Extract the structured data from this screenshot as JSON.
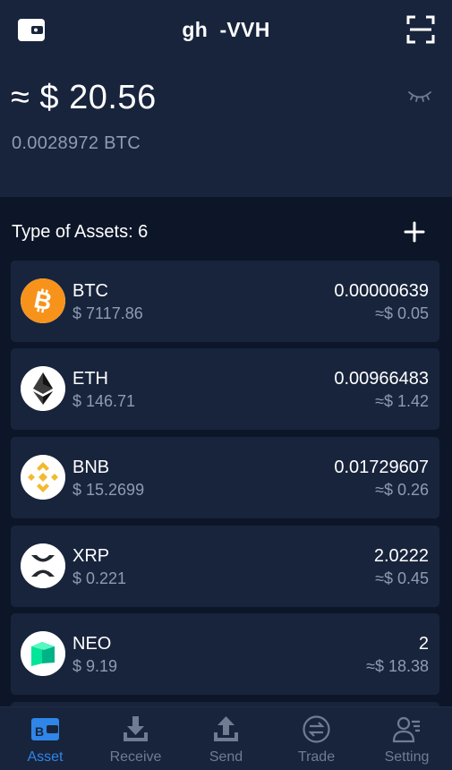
{
  "header": {
    "wallet_name": "gh  -VVH",
    "balance_usd": "≈ $ 20.56",
    "balance_btc": "0.0028972 BTC"
  },
  "assets": {
    "types_label": "Type of Assets: 6",
    "items": [
      {
        "symbol": "BTC",
        "price": "$ 7117.86",
        "amount": "0.00000639",
        "value": "≈$ 0.05",
        "icon": "bitcoin-icon",
        "color": "#f7931a"
      },
      {
        "symbol": "ETH",
        "price": "$ 146.71",
        "amount": "0.00966483",
        "value": "≈$ 1.42",
        "icon": "ethereum-icon",
        "color": "#3c3c3d"
      },
      {
        "symbol": "BNB",
        "price": "$ 15.2699",
        "amount": "0.01729607",
        "value": "≈$ 0.26",
        "icon": "binance-icon",
        "color": "#f3ba2f"
      },
      {
        "symbol": "XRP",
        "price": "$ 0.221",
        "amount": "2.0222",
        "value": "≈$ 0.45",
        "icon": "ripple-icon",
        "color": "#23292f"
      },
      {
        "symbol": "NEO",
        "price": "$ 9.19",
        "amount": "2",
        "value": "≈$ 18.38",
        "icon": "neo-icon",
        "color": "#00e599"
      }
    ]
  },
  "tabbar": {
    "tabs": [
      {
        "label": "Asset",
        "icon": "wallet-icon",
        "active": true
      },
      {
        "label": "Receive",
        "icon": "download-icon",
        "active": false
      },
      {
        "label": "Send",
        "icon": "upload-icon",
        "active": false
      },
      {
        "label": "Trade",
        "icon": "exchange-icon",
        "active": false
      },
      {
        "label": "Setting",
        "icon": "user-settings-icon",
        "active": false
      }
    ]
  },
  "colors": {
    "background": "#0d1628",
    "card": "#18243c",
    "muted_text": "#8f9bb0",
    "active_tab": "#2f86e8",
    "inactive_tab": "#6f7c92"
  }
}
